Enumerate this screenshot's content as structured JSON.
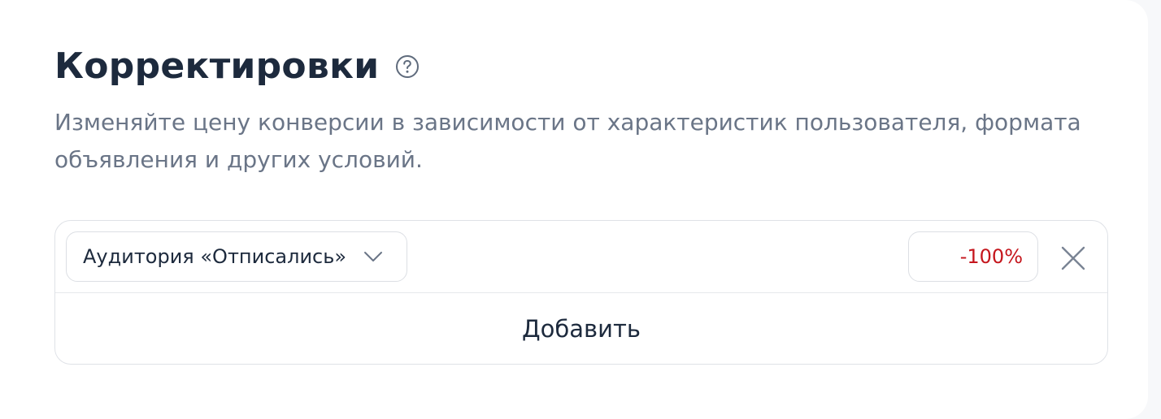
{
  "section": {
    "title": "Корректировки",
    "description": "Изменяйте цену конверсии в зависимости от характеристик пользователя, формата объявления и других условий.",
    "help_icon": "question-circle-icon"
  },
  "adjustments": [
    {
      "condition": "Аудитория «Отписались»",
      "value": "-100%",
      "dropdown_icon": "chevron-down-icon",
      "remove_icon": "close-icon"
    }
  ],
  "add_button": {
    "label": "Добавить"
  },
  "colors": {
    "title": "#1d2a3d",
    "description": "#6a7587",
    "negative_value": "#c5161d",
    "border": "#dfe2e7"
  }
}
